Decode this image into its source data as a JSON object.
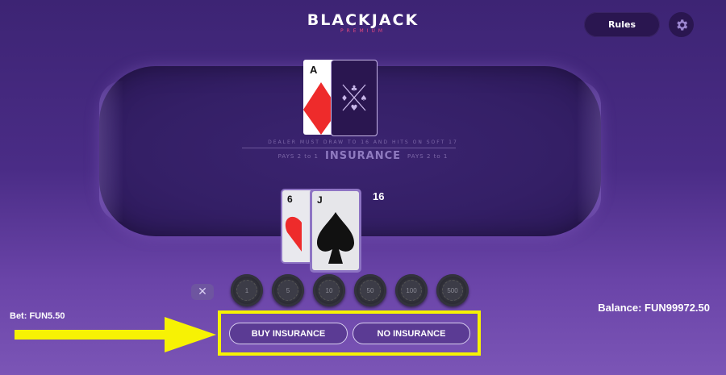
{
  "header": {
    "logo_title": "BLACKJACK",
    "logo_subtitle": "PREMIUM",
    "rules_label": "Rules",
    "settings_icon": "gear-icon"
  },
  "table": {
    "rule_text": "DEALER MUST DRAW TO 16 AND HITS ON SOFT 17",
    "insurance_title": "INSURANCE",
    "insurance_pays_left": "PAYS 2 to 1",
    "insurance_pays_right": "PAYS 2 to 1"
  },
  "dealer": {
    "up_card": {
      "rank": "A",
      "suit": "diamonds"
    },
    "hole_card": "face-down"
  },
  "player": {
    "cards": [
      {
        "rank": "6",
        "suit": "hearts"
      },
      {
        "rank": "J",
        "suit": "spades"
      }
    ],
    "total": "16"
  },
  "chips": [
    "1",
    "5",
    "10",
    "50",
    "100",
    "500"
  ],
  "clear_icon": "close-icon",
  "bet_text": "Bet: FUN5.50",
  "balance_text": "Balance: FUN99972.50",
  "actions": {
    "buy_insurance": "BUY INSURANCE",
    "no_insurance": "NO INSURANCE"
  },
  "colors": {
    "highlight": "#f7f204",
    "background": "#4a2c86",
    "diamond_red": "#ee2b2b"
  }
}
